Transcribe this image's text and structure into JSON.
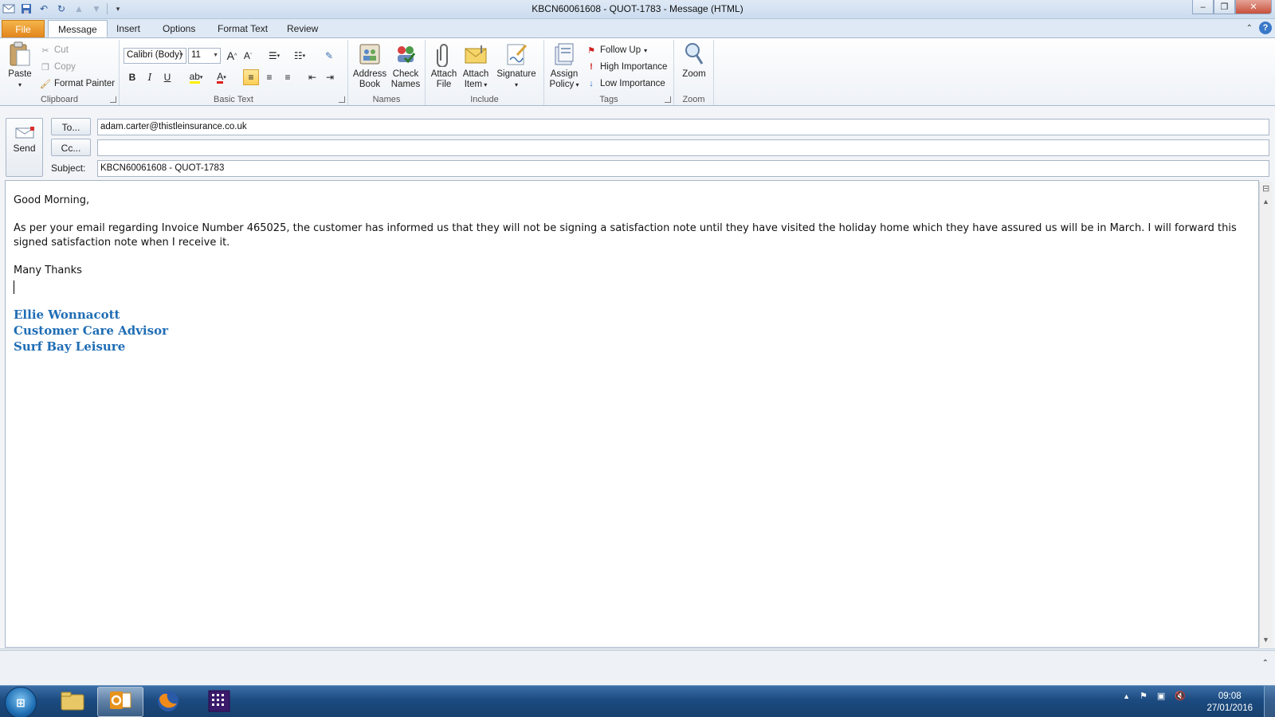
{
  "window": {
    "title": "KBCN60061608 - QUOT-1783  -  Message (HTML)",
    "minimize_label": "–",
    "restore_label": "❐",
    "close_label": "✕"
  },
  "tabs": {
    "file": "File",
    "message": "Message",
    "insert": "Insert",
    "options": "Options",
    "format_text": "Format Text",
    "review": "Review"
  },
  "ribbon": {
    "clipboard": {
      "paste": "Paste",
      "cut": "Cut",
      "copy": "Copy",
      "format_painter": "Format Painter",
      "label": "Clipboard"
    },
    "basic_text": {
      "font": "Calibri (Body)",
      "size": "11",
      "bold": "B",
      "italic": "I",
      "underline": "U",
      "label": "Basic Text"
    },
    "names": {
      "address_book_1": "Address",
      "address_book_2": "Book",
      "check_names_1": "Check",
      "check_names_2": "Names",
      "label": "Names"
    },
    "include": {
      "attach_file_1": "Attach",
      "attach_file_2": "File",
      "attach_item_1": "Attach",
      "attach_item_2": "Item",
      "signature": "Signature",
      "label": "Include"
    },
    "tags": {
      "assign_policy_1": "Assign",
      "assign_policy_2": "Policy",
      "follow_up": "Follow Up",
      "high_importance": "High Importance",
      "low_importance": "Low Importance",
      "label": "Tags"
    },
    "zoom": {
      "zoom": "Zoom",
      "label": "Zoom"
    }
  },
  "compose": {
    "send": "Send",
    "to_button": "To...",
    "cc_button": "Cc...",
    "subject_label": "Subject:",
    "to_value": "adam.carter@thistleinsurance.co.uk",
    "cc_value": "",
    "subject_value": "KBCN60061608 - QUOT-1783"
  },
  "body": {
    "greeting": "Good Morning,",
    "paragraph": "As per your email regarding Invoice Number 465025, the customer has informed us that they will not be signing a satisfaction note until they have visited the holiday home which they have assured us will be in March. I will forward this signed satisfaction note when I receive it.",
    "closing": "Many Thanks",
    "signature_name": "Ellie Wonnacott",
    "signature_title": "Customer Care Advisor",
    "signature_company": "Surf Bay Leisure"
  },
  "taskbar": {
    "time": "09:08",
    "date": "27/01/2016"
  },
  "colors": {
    "signature": "#1f6db5",
    "file_tab": "#e8911f"
  }
}
